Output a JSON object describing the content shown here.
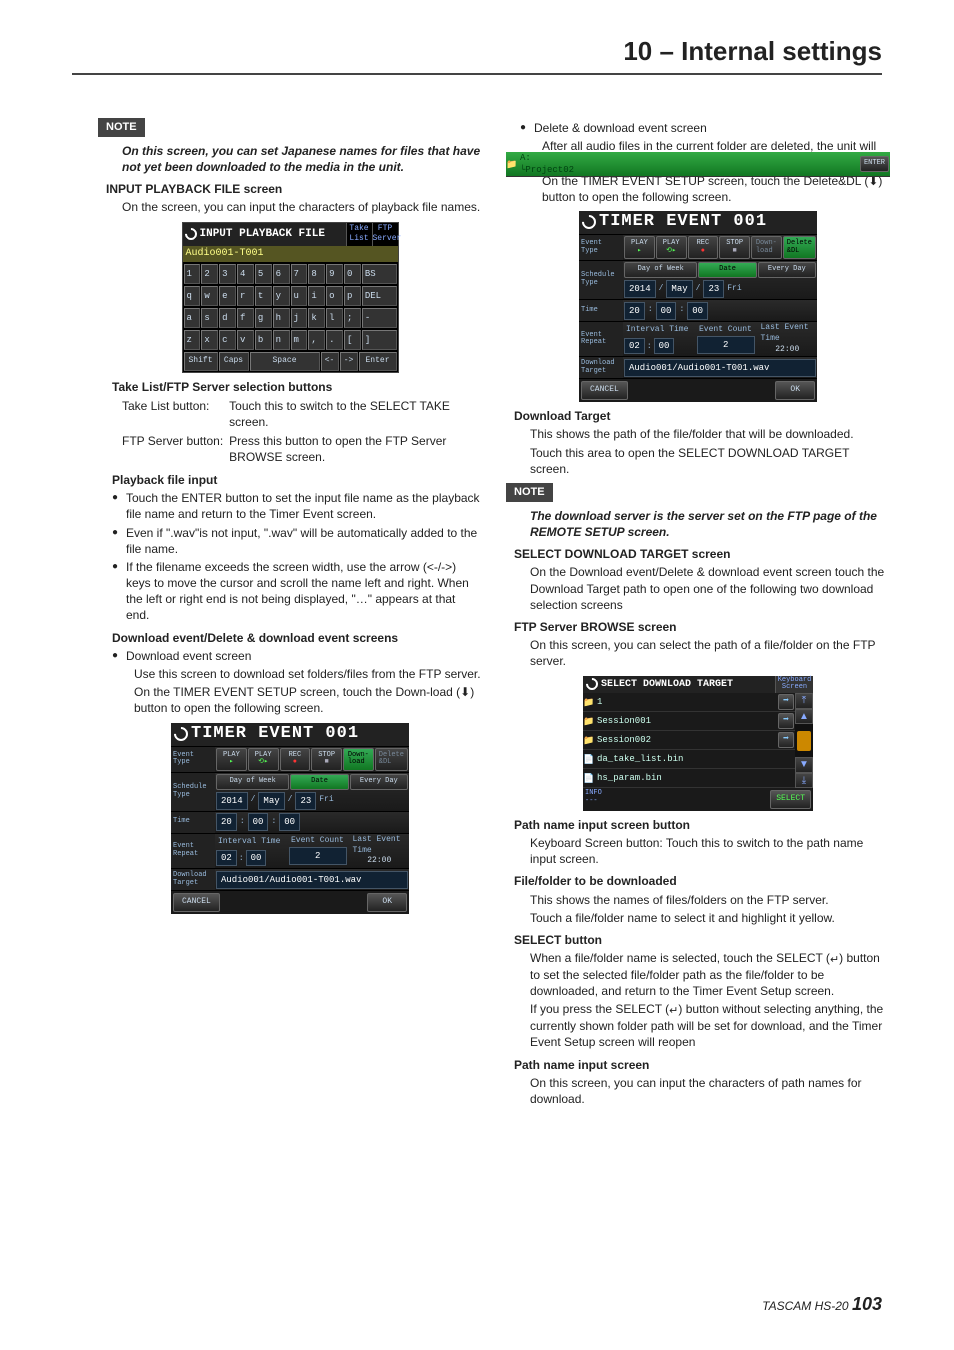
{
  "header": {
    "title": "10 – Internal settings"
  },
  "note_label": "NOTE",
  "left": {
    "note1": "On this screen, you can set Japanese names for files that have not yet been downloaded to the media in the unit.",
    "h_input": "INPUT PLAYBACK FILE screen",
    "p_input": "On the screen, you can input the characters of playback file names.",
    "kbd": {
      "title": "INPUT PLAYBACK FILE",
      "tab1": "Take\nList",
      "tab2": "FTP\nServer",
      "filename": "Audio001-T001",
      "r1": [
        "1",
        "2",
        "3",
        "4",
        "5",
        "6",
        "7",
        "8",
        "9",
        "0",
        "BS"
      ],
      "r2": [
        "q",
        "w",
        "e",
        "r",
        "t",
        "y",
        "u",
        "i",
        "o",
        "p",
        "DEL"
      ],
      "r3": [
        "a",
        "s",
        "d",
        "f",
        "g",
        "h",
        "j",
        "k",
        "l",
        ";",
        "-"
      ],
      "r4": [
        "z",
        "x",
        "c",
        "v",
        "b",
        "n",
        "m",
        ",",
        ".",
        "[",
        "]"
      ],
      "bot": [
        "Shift",
        "Caps",
        "Space",
        "<-",
        "->",
        "Enter"
      ]
    },
    "h_buttons": "Take List/FTP Server selection buttons",
    "tbl": [
      [
        "Take List button:",
        "Touch this to switch to the SELECT TAKE screen."
      ],
      [
        "FTP Server button:",
        "Press this button to open the FTP Server BROWSE screen."
      ]
    ],
    "h_playback": "Playback file input",
    "b1": "Touch the ENTER button to set the input file name as the playback file name and return to the Timer Event  screen.",
    "b2": "Even if \".wav\"is not input, \".wav\" will be automatically added to the file name.",
    "b3": "If the filename exceeds the screen width, use the arrow (<-/->) keys to move the cursor and scroll the name left and right. When the left or right end is not being displayed, \"…\" appears at that end.",
    "h_dl": "Download event/Delete & download event screens",
    "b4": "Download event screen",
    "p_dl1": "Use this screen to download set folders/files from the FTP server.",
    "p_dl2": "On the TIMER EVENT SETUP screen, touch the Down-load (⬇) button to open the following screen.",
    "timer": {
      "title": "TIMER EVENT 001",
      "r1_lbl": "Event\nType",
      "r1_btns": [
        "PLAY",
        "PLAY",
        "REC",
        "STOP",
        "Down-\nload",
        "Delete\n&DL"
      ],
      "r2_lbl": "Schedule\nType",
      "r2_btn1": "Day of Week",
      "r2_btn2": "Date",
      "r2_btn3": "Every Day",
      "r2_date": [
        "2014",
        "/",
        "May",
        "/",
        "23",
        "Fri"
      ],
      "r3_lbl": "Time",
      "r3": [
        "20",
        ":",
        "00",
        ":",
        "00"
      ],
      "r4_lbl": "Event\nRepeat",
      "r4_a": "Interval Time",
      "r4_av": [
        "02",
        ":",
        "00"
      ],
      "r4_b": "Event Count",
      "r4_bv": "2",
      "r4_c": "Last Event Time",
      "r4_cv": "22:00",
      "r5_lbl": "Download\nTarget",
      "r5_v": "Audio001/Audio001-T001.wav",
      "cancel": "CANCEL",
      "ok": "OK"
    }
  },
  "right": {
    "b1": "Delete & download event screen",
    "p1": "After all audio files in the current folder are deleted, the unit will download set folders/files from the FTP server.",
    "p2": "On the TIMER EVENT SETUP screen, touch the Delete&DL (⬇) button to open the following screen.",
    "h_dt": "Download Target",
    "p_dt1": "This shows the path of the file/folder that will be downloaded.",
    "p_dt2": "Touch this area to open the SELECT DOWNLOAD TARGET screen.",
    "note1": "The download server is the server set on the FTP page of the REMOTE SETUP screen.",
    "h_sdt": "SELECT DOWNLOAD TARGET screen",
    "p_sdt": "On the Download event/Delete & download event screen touch the Download Target path to open one of the following two download selection screens",
    "h_ftp": "FTP Server BROWSE screen",
    "p_ftp": "On this screen, you can select the path of a file/folder on the FTP server.",
    "browse": {
      "title": "SELECT DOWNLOAD TARGET",
      "tab": "Keyboard\nScreen",
      "header_path": "A:\n └Project02",
      "rows": [
        {
          "ico": "📁",
          "nm": "1",
          "btn": "arrow"
        },
        {
          "ico": "📁",
          "nm": "Session001",
          "btn": "arrow"
        },
        {
          "ico": "📁",
          "nm": "Session002",
          "btn": "arrow"
        },
        {
          "ico": "📄",
          "nm": "da_take_list.bin",
          "btn": ""
        },
        {
          "ico": "📄",
          "nm": "hs_param.bin",
          "btn": ""
        }
      ],
      "enter": "ENTER",
      "info": "INFO\n---",
      "select": "SELECT"
    },
    "h_pnib": "Path name input screen button",
    "p_pnib": "Keyboard Screen button: Touch this to switch to the path name input screen.",
    "h_ff": "File/folder to be downloaded",
    "p_ff1": "This shows the names of files/folders on the FTP server.",
    "p_ff2": "Touch a file/folder name to select it and highlight it yellow.",
    "h_sel": "SELECT button",
    "p_sel1a": "When a file/folder name is selected, touch the SELECT (",
    "p_sel1b": ") button to set the selected file/folder path as the file/folder to be downloaded, and return to the Timer Event Setup screen.",
    "p_sel2a": "If you press the SELECT (",
    "p_sel2b": ") button without selecting anything, the currently shown folder path will be set for download, and the Timer Event Setup screen will reopen",
    "h_pnis": "Path name input screen",
    "p_pnis": "On this screen, you can input the characters of path names for download."
  },
  "footer": {
    "brand": "TASCAM HS-20",
    "page": "103"
  }
}
